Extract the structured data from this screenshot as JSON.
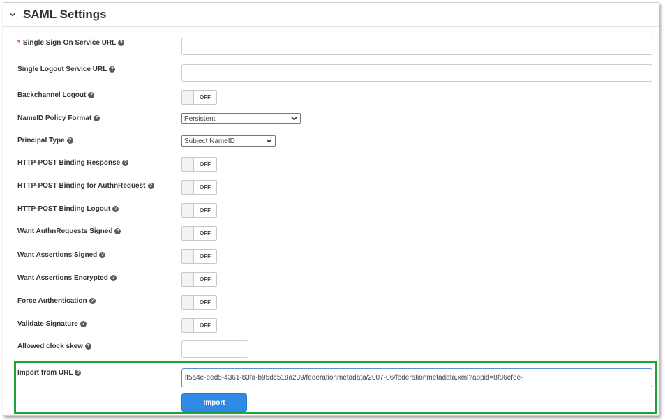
{
  "header": {
    "title": "SAML Settings"
  },
  "fields": {
    "sso_url": {
      "label": "Single Sign-On Service URL",
      "required_mark": "*",
      "value": ""
    },
    "slo_url": {
      "label": "Single Logout Service URL",
      "value": ""
    },
    "backchannel_logout": {
      "label": "Backchannel Logout",
      "state": "OFF"
    },
    "nameid_policy": {
      "label": "NameID Policy Format",
      "selected": "Persistent"
    },
    "principal_type": {
      "label": "Principal Type",
      "selected": "Subject NameID"
    },
    "http_post_binding_response": {
      "label": "HTTP-POST Binding Response",
      "state": "OFF"
    },
    "http_post_binding_authn": {
      "label": "HTTP-POST Binding for AuthnRequest",
      "state": "OFF"
    },
    "http_post_binding_logout": {
      "label": "HTTP-POST Binding Logout",
      "state": "OFF"
    },
    "want_authn_signed": {
      "label": "Want AuthnRequests Signed",
      "state": "OFF"
    },
    "want_assertions_signed": {
      "label": "Want Assertions Signed",
      "state": "OFF"
    },
    "want_assertions_encrypted": {
      "label": "Want Assertions Encrypted",
      "state": "OFF"
    },
    "force_authentication": {
      "label": "Force Authentication",
      "state": "OFF"
    },
    "validate_signature": {
      "label": "Validate Signature",
      "state": "OFF"
    },
    "clock_skew": {
      "label": "Allowed clock skew",
      "value": ""
    },
    "import_url": {
      "label": "Import from URL",
      "value": "lf5a4e-eed5-4361-83fa-b95dc518a239/federationmetadata/2007-06/federationmetadata.xml?appid=8f86efde-"
    }
  },
  "import_button": {
    "label": "Import"
  },
  "colors": {
    "highlight": "#1fa33b",
    "button": "#2e8ae6",
    "required": "#d9534f"
  },
  "icons": {
    "collapse": "chevron-down-icon",
    "help": "question-circle-icon",
    "dropdown": "chevron-down-icon"
  }
}
